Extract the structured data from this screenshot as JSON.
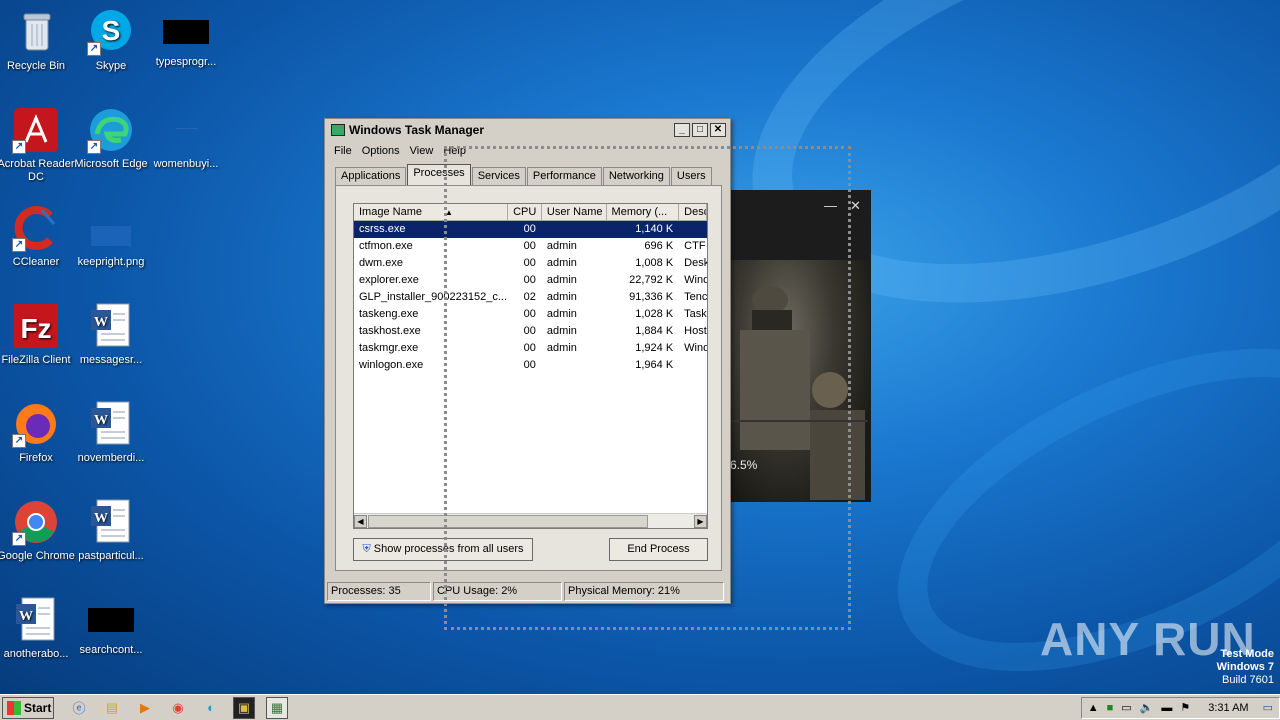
{
  "desktop": {
    "icons": [
      {
        "label": "Recycle Bin",
        "icon": "recycle-bin-icon"
      },
      {
        "label": "Skype",
        "icon": "skype-icon"
      },
      {
        "label": "typesprogr...",
        "icon": "blank-file-icon"
      },
      {
        "label": "Acrobat Reader DC",
        "icon": "acrobat-icon"
      },
      {
        "label": "Microsoft Edge",
        "icon": "edge-icon"
      },
      {
        "label": "womenbuyi...",
        "icon": "blank-file-icon"
      },
      {
        "label": "CCleaner",
        "icon": "ccleaner-icon"
      },
      {
        "label": "keepright.png",
        "icon": "image-file-icon"
      },
      {
        "label": "FileZilla Client",
        "icon": "filezilla-icon"
      },
      {
        "label": "messagesr...",
        "icon": "word-doc-icon"
      },
      {
        "label": "Firefox",
        "icon": "firefox-icon"
      },
      {
        "label": "novemberdi...",
        "icon": "word-doc-icon"
      },
      {
        "label": "Google Chrome",
        "icon": "chrome-icon"
      },
      {
        "label": "pastparticul...",
        "icon": "word-doc-icon"
      },
      {
        "label": "anotherabo...",
        "icon": "word-doc-icon"
      },
      {
        "label": "searchcont...",
        "icon": "blank-file-icon"
      }
    ]
  },
  "taskmanager": {
    "title": "Windows Task Manager",
    "menu": [
      "File",
      "Options",
      "View",
      "Help"
    ],
    "tabs": [
      "Applications",
      "Processes",
      "Services",
      "Performance",
      "Networking",
      "Users"
    ],
    "active_tab": "Processes",
    "columns": [
      "Image Name",
      "CPU",
      "User Name",
      "Memory (...",
      "Desc"
    ],
    "rows": [
      {
        "name": "csrss.exe",
        "cpu": "00",
        "user": "",
        "mem": "1,140 K",
        "desc": "",
        "selected": true
      },
      {
        "name": "ctfmon.exe",
        "cpu": "00",
        "user": "admin",
        "mem": "696 K",
        "desc": "CTF I"
      },
      {
        "name": "dwm.exe",
        "cpu": "00",
        "user": "admin",
        "mem": "1,008 K",
        "desc": "Desk"
      },
      {
        "name": "explorer.exe",
        "cpu": "00",
        "user": "admin",
        "mem": "22,792 K",
        "desc": "Wind"
      },
      {
        "name": "GLP_installer_900223152_c...",
        "cpu": "02",
        "user": "admin",
        "mem": "91,336 K",
        "desc": "Tenc"
      },
      {
        "name": "taskeng.exe",
        "cpu": "00",
        "user": "admin",
        "mem": "1,028 K",
        "desc": "Task"
      },
      {
        "name": "taskhost.exe",
        "cpu": "00",
        "user": "admin",
        "mem": "1,884 K",
        "desc": "Host"
      },
      {
        "name": "taskmgr.exe",
        "cpu": "00",
        "user": "admin",
        "mem": "1,924 K",
        "desc": "Wind"
      },
      {
        "name": "winlogon.exe",
        "cpu": "00",
        "user": "",
        "mem": "1,964 K",
        "desc": ""
      }
    ],
    "show_all_label": "Show processes from all users",
    "end_process_label": "End Process",
    "status": {
      "processes": "Processes: 35",
      "cpu": "CPU Usage: 2%",
      "memory": "Physical Memory: 21%"
    }
  },
  "game_window": {
    "progress_text": "6.5%"
  },
  "watermark": {
    "brand": "ANY RUN",
    "test_mode": "Test Mode",
    "os": "Windows 7",
    "build": "Build 7601"
  },
  "taskbar": {
    "start_label": "Start",
    "pinned": [
      "ie-icon",
      "explorer-icon",
      "media-player-icon",
      "chrome-icon",
      "edge-icon",
      "game-installer-icon",
      "task-manager-icon"
    ],
    "clock": "3:31 AM"
  }
}
